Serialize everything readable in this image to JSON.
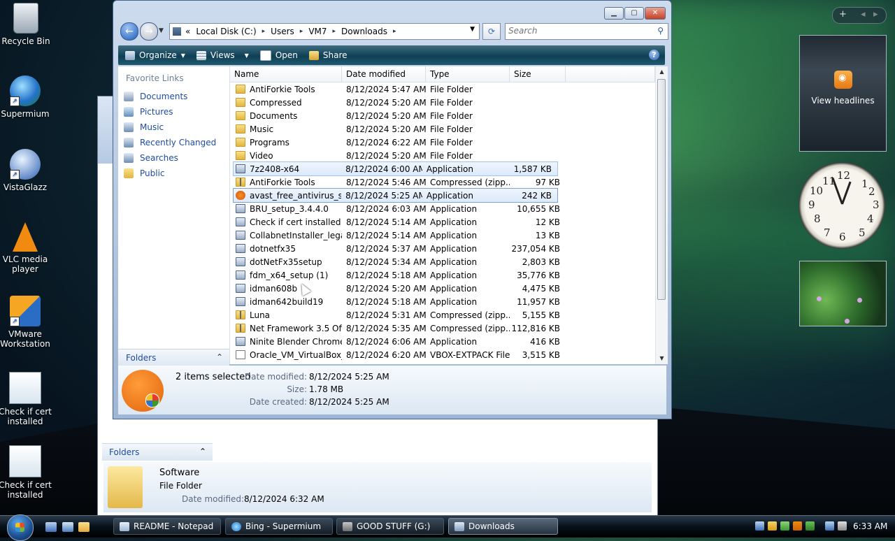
{
  "desktop": {
    "icons": [
      {
        "label": "Recycle Bin",
        "icon": "recycle-bin-icon"
      },
      {
        "label": "Supermium",
        "icon": "supermium-icon"
      },
      {
        "label": "VistaGlazz",
        "icon": "vistaglazz-icon"
      },
      {
        "label": "VLC media player",
        "icon": "vlc-icon"
      },
      {
        "label": "VMware Workstation",
        "icon": "vmware-icon"
      },
      {
        "label": "Check if cert installed",
        "icon": "app-window-icon"
      },
      {
        "label": "Check if cert installed",
        "icon": "app-window-icon"
      }
    ]
  },
  "background_window": {
    "folders_label": "Folders",
    "details": {
      "name": "Software",
      "type": "File Folder",
      "date_modified_label": "Date modified:",
      "date_modified": "8/12/2024 6:32 AM"
    }
  },
  "explorer": {
    "address": {
      "prefix": "«",
      "crumbs": [
        "Local Disk (C:)",
        "Users",
        "VM7",
        "Downloads"
      ]
    },
    "search": {
      "placeholder": "Search"
    },
    "toolbar": {
      "organize": "Organize",
      "views": "Views",
      "open": "Open",
      "share": "Share"
    },
    "sidebar": {
      "heading": "Favorite Links",
      "links": [
        "Documents",
        "Pictures",
        "Music",
        "Recently Changed",
        "Searches",
        "Public"
      ],
      "folders_label": "Folders"
    },
    "columns": [
      "Name",
      "Date modified",
      "Type",
      "Size"
    ],
    "rows": [
      {
        "name": "AntiForkie Tools",
        "date": "8/12/2024 5:47 AM",
        "type": "File Folder",
        "size": "",
        "icon": "folder"
      },
      {
        "name": "Compressed",
        "date": "8/12/2024 5:20 AM",
        "type": "File Folder",
        "size": "",
        "icon": "folder"
      },
      {
        "name": "Documents",
        "date": "8/12/2024 5:20 AM",
        "type": "File Folder",
        "size": "",
        "icon": "folder"
      },
      {
        "name": "Music",
        "date": "8/12/2024 5:20 AM",
        "type": "File Folder",
        "size": "",
        "icon": "folder"
      },
      {
        "name": "Programs",
        "date": "8/12/2024 6:22 AM",
        "type": "File Folder",
        "size": "",
        "icon": "folder"
      },
      {
        "name": "Video",
        "date": "8/12/2024 5:20 AM",
        "type": "File Folder",
        "size": "",
        "icon": "folder"
      },
      {
        "name": "7z2408-x64",
        "date": "8/12/2024 6:00 AM",
        "type": "Application",
        "size": "1,587 KB",
        "icon": "app"
      },
      {
        "name": "AntiForkie Tools",
        "date": "8/12/2024 5:46 AM",
        "type": "Compressed (zipp...",
        "size": "97 KB",
        "icon": "zip"
      },
      {
        "name": "avast_free_antivirus_se...",
        "date": "8/12/2024 5:25 AM",
        "type": "Application",
        "size": "242 KB",
        "icon": "avast"
      },
      {
        "name": "BRU_setup_3.4.4.0",
        "date": "8/12/2024 6:03 AM",
        "type": "Application",
        "size": "10,655 KB",
        "icon": "app"
      },
      {
        "name": "Check if cert installed",
        "date": "8/12/2024 5:14 AM",
        "type": "Application",
        "size": "12 KB",
        "icon": "app"
      },
      {
        "name": "CollabnetInstaller_lega...",
        "date": "8/12/2024 5:14 AM",
        "type": "Application",
        "size": "13 KB",
        "icon": "app"
      },
      {
        "name": "dotnetfx35",
        "date": "8/12/2024 5:37 AM",
        "type": "Application",
        "size": "237,054 KB",
        "icon": "app"
      },
      {
        "name": "dotNetFx35setup",
        "date": "8/12/2024 5:34 AM",
        "type": "Application",
        "size": "2,803 KB",
        "icon": "app"
      },
      {
        "name": "fdm_x64_setup (1)",
        "date": "8/12/2024 5:18 AM",
        "type": "Application",
        "size": "35,776 KB",
        "icon": "app"
      },
      {
        "name": "idman608b",
        "date": "8/12/2024 5:20 AM",
        "type": "Application",
        "size": "4,475 KB",
        "icon": "app"
      },
      {
        "name": "idman642build19",
        "date": "8/12/2024 5:18 AM",
        "type": "Application",
        "size": "11,957 KB",
        "icon": "app"
      },
      {
        "name": "Luna",
        "date": "8/12/2024 5:31 AM",
        "type": "Compressed (zipp...",
        "size": "5,155 KB",
        "icon": "zip"
      },
      {
        "name": "Net Framework 3.5 Off...",
        "date": "8/12/2024 5:35 AM",
        "type": "Compressed (zipp...",
        "size": "112,816 KB",
        "icon": "zip"
      },
      {
        "name": "Ninite Blender Chrome...",
        "date": "8/12/2024 6:06 AM",
        "type": "Application",
        "size": "416 KB",
        "icon": "app"
      },
      {
        "name": "Oracle_VM_VirtualBox_...",
        "date": "8/12/2024 6:20 AM",
        "type": "VBOX-EXTPACK File",
        "size": "3,515 KB",
        "icon": "file"
      }
    ],
    "details": {
      "summary": "2 items selected",
      "date_modified_label": "Date modified:",
      "date_modified": "8/12/2024 5:25 AM",
      "size_label": "Size:",
      "size": "1.78 MB",
      "date_created_label": "Date created:",
      "date_created": "8/12/2024 5:25 AM"
    }
  },
  "gadgets": {
    "feed_label": "View headlines",
    "controls": {
      "add": "+",
      "prev": "◂",
      "next": "▸"
    }
  },
  "taskbar": {
    "tasks": [
      "README - Notepad",
      "Bing - Supermium",
      "GOOD STUFF (G:)",
      "Downloads"
    ],
    "clock": "6:33 AM"
  }
}
